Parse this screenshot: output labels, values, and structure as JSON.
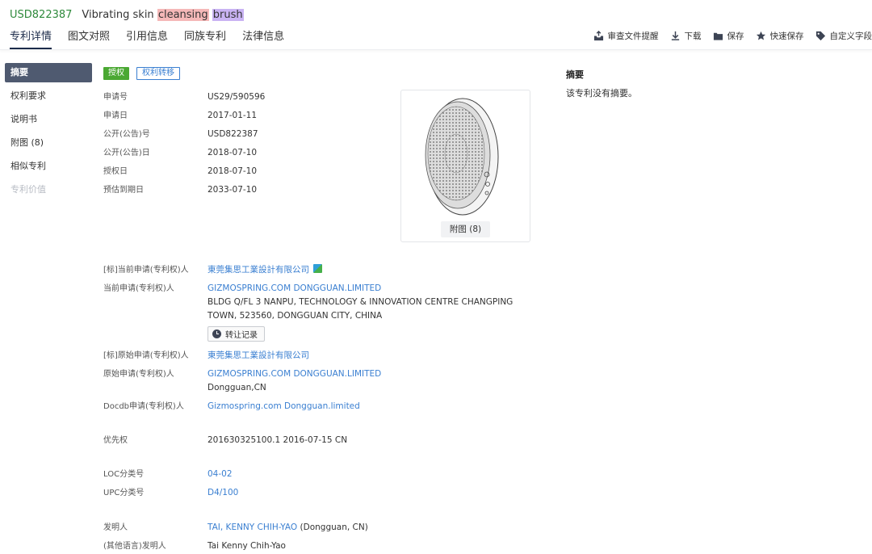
{
  "header": {
    "pub_number": "USD822387",
    "title_parts": [
      {
        "text": "Vibrating skin ",
        "hl": ""
      },
      {
        "text": "cleansing",
        "hl": "red"
      },
      {
        "text": " ",
        "hl": ""
      },
      {
        "text": "brush",
        "hl": "purple"
      }
    ]
  },
  "tabs": [
    {
      "label": "专利详情",
      "active": true
    },
    {
      "label": "图文对照",
      "active": false
    },
    {
      "label": "引用信息",
      "active": false
    },
    {
      "label": "同族专利",
      "active": false
    },
    {
      "label": "法律信息",
      "active": false
    }
  ],
  "toolbar": {
    "review": "审查文件提醒",
    "download": "下载",
    "save": "保存",
    "quick_save": "快速保存",
    "custom": "自定义字段"
  },
  "leftnav": [
    {
      "label": "摘要",
      "state": "active"
    },
    {
      "label": "权利要求",
      "state": "normal"
    },
    {
      "label": "说明书",
      "state": "normal"
    },
    {
      "label": "附图 (8)",
      "state": "normal"
    },
    {
      "label": "相似专利",
      "state": "normal"
    },
    {
      "label": "专利价值",
      "state": "disabled"
    }
  ],
  "badges": {
    "granted": "授权",
    "transfer": "权利转移"
  },
  "basic_info": {
    "app_no_label": "申请号",
    "app_no": "US29/590596",
    "app_date_label": "申请日",
    "app_date": "2017-01-11",
    "pub_no_label": "公开(公告)号",
    "pub_no": "USD822387",
    "pub_date_label": "公开(公告)日",
    "pub_date": "2018-07-10",
    "grant_date_label": "授权日",
    "grant_date": "2018-07-10",
    "expiry_label": "预估到期日",
    "expiry": "2033-07-10"
  },
  "figure": {
    "caption": "附图 (8)"
  },
  "parties": {
    "std_current_label": "[标]当前申请(专利权)人",
    "std_current": "東莞集思工業設計有限公司",
    "current_label": "当前申请(专利权)人",
    "current": "GIZMOSPRING.COM DONGGUAN.LIMITED",
    "current_addr1": "BLDG Q/FL 3 NANPU, TECHNOLOGY & INNOVATION CENTRE CHANGPING",
    "current_addr2": "TOWN, 523560, DONGGUAN CITY, CHINA",
    "transfer_record": "转让记录",
    "std_original_label": "[标]原始申请(专利权)人",
    "std_original": "東莞集思工業設計有限公司",
    "original_label": "原始申请(专利权)人",
    "original": "GIZMOSPRING.COM DONGGUAN.LIMITED",
    "original_loc": "Dongguan,CN",
    "docdb_label": "Docdb申请(专利权)人",
    "docdb": "Gizmospring.com Dongguan.limited"
  },
  "priority": {
    "label": "优先权",
    "value": "201630325100.1 2016-07-15 CN"
  },
  "classification": {
    "loc_label": "LOC分类号",
    "loc": "04-02",
    "upc_label": "UPC分类号",
    "upc": "D4/100"
  },
  "inventors": {
    "label": "发明人",
    "name": "TAI, KENNY CHIH-YAO",
    "loc": "(Dongguan, CN)",
    "other_label": "(其他语言)发明人",
    "other": "Tai Kenny Chih-Yao"
  },
  "abstract": {
    "title": "摘要",
    "text": "该专利没有摘要。"
  },
  "colors": {
    "accent": "#3a7fd1",
    "pub_number": "#2f8a3c",
    "granted": "#4aa832",
    "nav_active": "#4f5a70"
  }
}
